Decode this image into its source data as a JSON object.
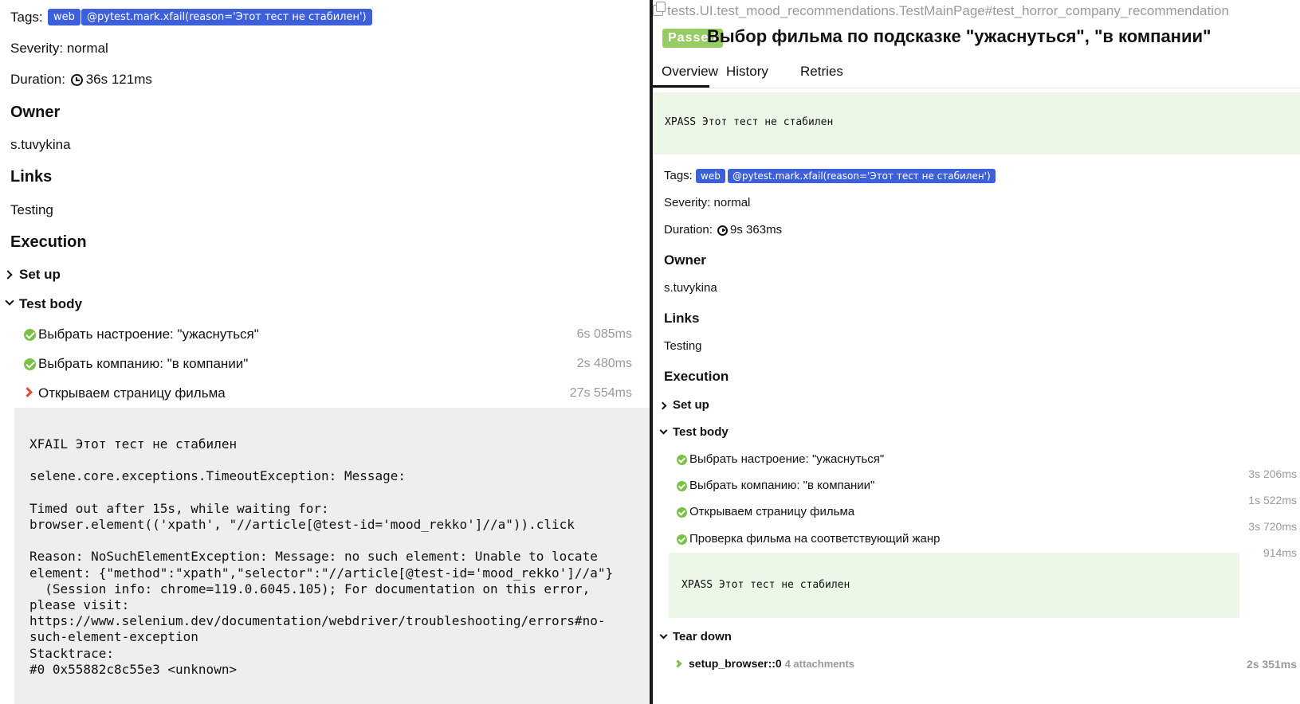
{
  "left": {
    "tags_label": "Tags:",
    "tags": [
      "web",
      "@pytest.mark.xfail(reason='Этот тест не стабилен')"
    ],
    "severity": "Severity: normal",
    "duration_label": "Duration:",
    "duration_value": "36s 121ms",
    "owner_heading": "Owner",
    "owner": "s.tuvykina",
    "links_heading": "Links",
    "link": "Testing",
    "execution_heading": "Execution",
    "setup_label": "Set up",
    "test_body_label": "Test body",
    "steps": [
      {
        "label": "Выбрать настроение: \"ужаснуться\"",
        "duration": "6s 085ms",
        "status": "passed"
      },
      {
        "label": "Выбрать компанию: \"в компании\"",
        "duration": "2s 480ms",
        "status": "passed"
      },
      {
        "label": "Открываем страницу фильма",
        "duration": "27s 554ms",
        "status": "failed"
      }
    ],
    "trace": "XFAIL Этот тест не стабилен\n\nselene.core.exceptions.TimeoutException: Message:\n\nTimed out after 15s, while waiting for:\nbrowser.element(('xpath', \"//article[@test-id='mood_rekko']//a\")).click\n\nReason: NoSuchElementException: Message: no such element: Unable to locate\nelement: {\"method\":\"xpath\",\"selector\":\"//article[@test-id='mood_rekko']//a\"}\n  (Session info: chrome=119.0.6045.105); For documentation on this error,\nplease visit:\nhttps://www.selenium.dev/documentation/webdriver/troubleshooting/errors#no-\nsuch-element-exception\nStacktrace:\n#0 0x55882c8c55e3 <unknown>"
  },
  "right": {
    "title_path": "tests.UI.test_mood_recommendations.TestMainPage#test_horror_company_recommendation",
    "status": "Passed",
    "heading": "Выбор фильма по подсказке \"ужаснуться\", \"в компании\"",
    "tabs": [
      "Overview",
      "History",
      "Retries"
    ],
    "active_tab": "Overview",
    "xpass_message": "XPASS Этот тест не стабилен",
    "tags_label": "Tags:",
    "tags": [
      "web",
      "@pytest.mark.xfail(reason='Этот тест не стабилен')"
    ],
    "severity": "Severity: normal",
    "duration_label": "Duration:",
    "duration_value": "9s 363ms",
    "owner_heading": "Owner",
    "owner": "s.tuvykina",
    "links_heading": "Links",
    "link": "Testing",
    "execution_heading": "Execution",
    "setup_label": "Set up",
    "test_body_label": "Test body",
    "steps": [
      {
        "label": "Выбрать настроение: \"ужаснуться\"",
        "duration": "3s 206ms",
        "status": "passed"
      },
      {
        "label": "Выбрать компанию: \"в компании\"",
        "duration": "1s 522ms",
        "status": "passed"
      },
      {
        "label": "Открываем страницу фильма",
        "duration": "3s 720ms",
        "status": "passed"
      },
      {
        "label": "Проверка фильма на соответствующий жанр",
        "duration": "914ms",
        "status": "passed"
      }
    ],
    "inner_xpass": "XPASS Этот тест не стабилен",
    "teardown_label": "Tear down",
    "teardown_step": "setup_browser::0",
    "teardown_attachments": "4 attachments",
    "teardown_duration": "2s 351ms"
  },
  "colors": {
    "tag_badge": "#3d5fd9",
    "passed": "#97cc64",
    "ok_icon": "#7ac143",
    "failed_chevron": "#e24a2f",
    "xpass_background": "#edf7e7",
    "trace_background": "#eeeeee"
  }
}
